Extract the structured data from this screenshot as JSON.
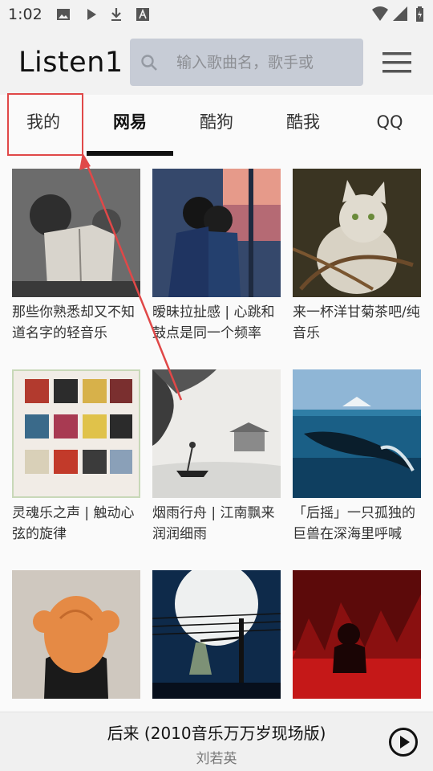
{
  "status_bar": {
    "time": "1:02"
  },
  "header": {
    "title": "Listen1",
    "search_placeholder": "输入歌曲名，歌手或"
  },
  "tabs": [
    {
      "label": "我的"
    },
    {
      "label": "网易"
    },
    {
      "label": "酷狗"
    },
    {
      "label": "酷我"
    },
    {
      "label": "QQ"
    }
  ],
  "active_tab": "网易",
  "playlists": [
    {
      "title": "那些你熟悉却又不知道名字的轻音乐"
    },
    {
      "title": "暧昧拉扯感 | 心跳和鼓点是同一个频率"
    },
    {
      "title": "来一杯洋甘菊茶吧/纯音乐"
    },
    {
      "title": "灵魂乐之声 | 触动心弦的旋律"
    },
    {
      "title": "烟雨行舟 | 江南飘来润润细雨"
    },
    {
      "title": "「后摇」一只孤独的巨兽在深海里呼喊"
    },
    {
      "title": ""
    },
    {
      "title": ""
    },
    {
      "title": ""
    }
  ],
  "player": {
    "song": "后来 (2010音乐万万岁现场版)",
    "artist": "刘若英"
  },
  "colors": {
    "accent": "#111111",
    "search_bg": "#c7ccd6",
    "annotation": "#e04848"
  }
}
